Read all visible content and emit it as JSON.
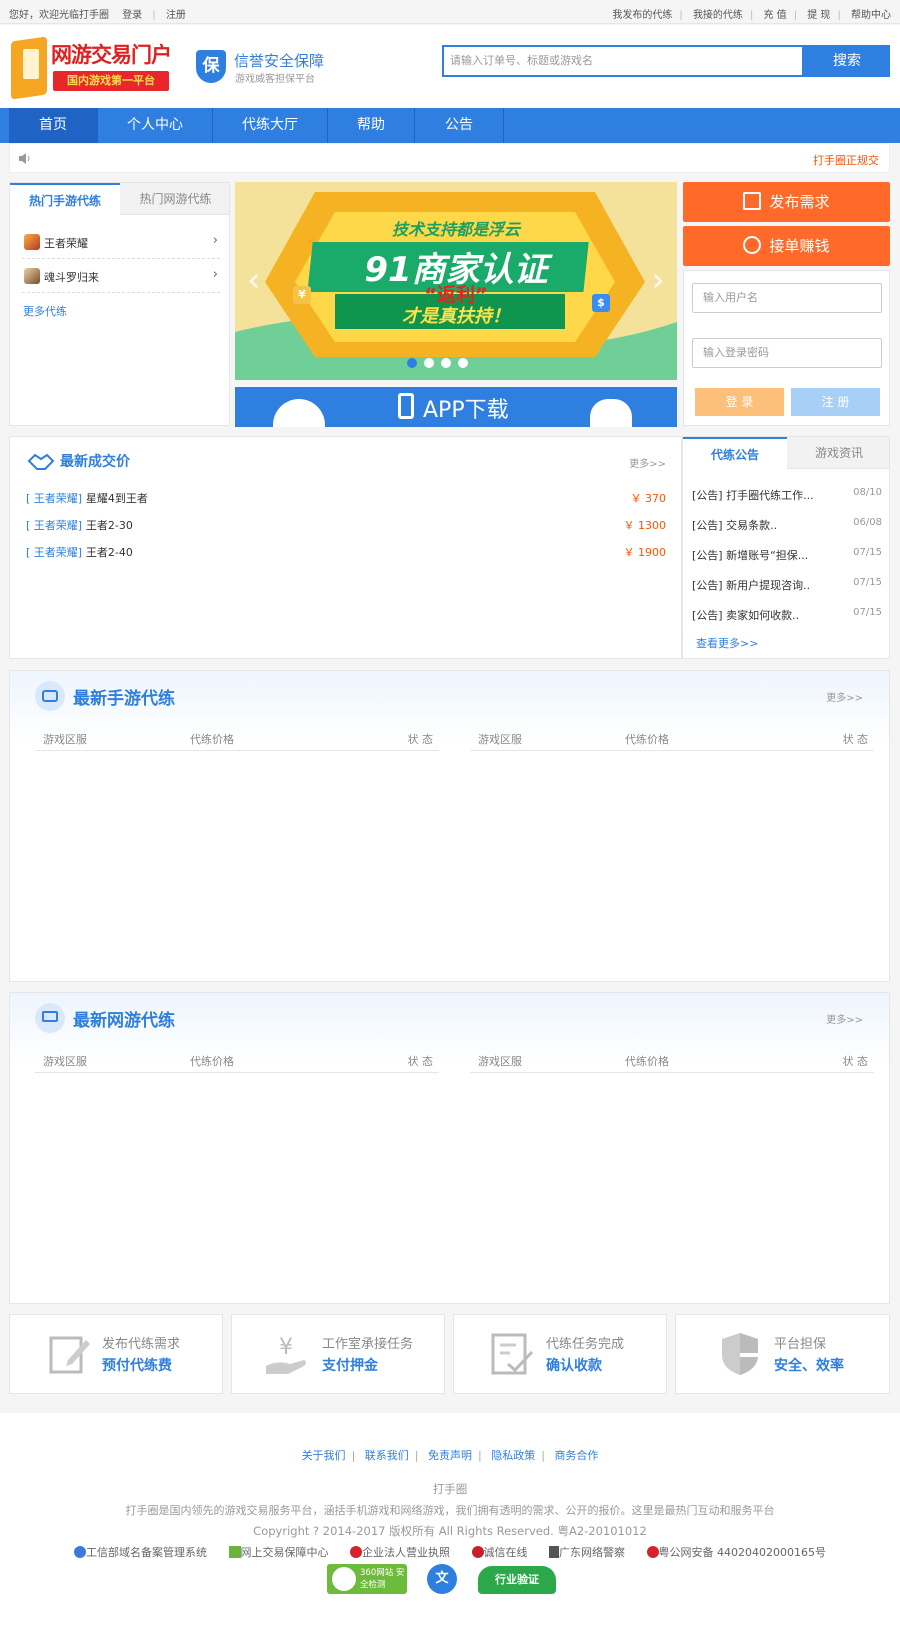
{
  "topbar": {
    "greeting": "您好，欢迎光临打手圈",
    "login": "登录",
    "register": "注册",
    "links": [
      "我发布的代练",
      "我接的代练",
      "充 值",
      "提 现",
      "帮助中心"
    ]
  },
  "header": {
    "logo_title": "网游交易门户",
    "logo_sub": "国内游戏第一平台",
    "shield_char": "保",
    "guarantee_title": "信誉安全保障",
    "guarantee_sub": "游戏威客担保平台",
    "search_placeholder": "请输入订单号、标题或游戏名",
    "search_button": "搜索"
  },
  "nav": [
    "首页",
    "个人中心",
    "代练大厅",
    "帮助",
    "公告"
  ],
  "notice": {
    "text": "打手圈正规交"
  },
  "hot": {
    "tabs": [
      "热门手游代练",
      "热门网游代练"
    ],
    "items": [
      "王者荣耀",
      "魂斗罗归来"
    ],
    "more": "更多代练"
  },
  "banner": {
    "line1": "技术支持都是浮云",
    "line2": "91商家认证",
    "line3": "“返利”",
    "line4": "才是真扶持！",
    "badge1": "¥",
    "badge2": "$",
    "dots": 4,
    "app_download": "APP下载"
  },
  "side": {
    "publish": "发布需求",
    "earn": "接单赚钱",
    "username_placeholder": "输入用户名",
    "password_placeholder": "输入登录密码",
    "login": "登 录",
    "register": "注 册"
  },
  "deals": {
    "title": "最新成交价",
    "more": "更多>>",
    "rows": [
      {
        "tag": "[ 王者荣耀]",
        "name": "星耀4到王者",
        "price": "￥ 370"
      },
      {
        "tag": "[ 王者荣耀]",
        "name": "王者2-30",
        "price": "￥ 1300"
      },
      {
        "tag": "[ 王者荣耀]",
        "name": "王者2-40",
        "price": "￥ 1900"
      }
    ]
  },
  "announce": {
    "tabs": [
      "代练公告",
      "游戏资讯"
    ],
    "items": [
      {
        "text": "[公告] 打手圈代练工作...",
        "date": "08/10"
      },
      {
        "text": "[公告] 交易条款..",
        "date": "06/08"
      },
      {
        "text": "[公告] 新增账号“担保...",
        "date": "07/15"
      },
      {
        "text": "[公告] 新用户提现咨询..",
        "date": "07/15"
      },
      {
        "text": "[公告] 卖家如何收款..",
        "date": "07/15"
      }
    ],
    "more": "查看更多>>"
  },
  "mobile_section": {
    "title": "最新手游代练",
    "more": "更多>>",
    "cols": [
      "游戏区服",
      "代练价格",
      "状 态"
    ]
  },
  "pc_section": {
    "title": "最新网游代练",
    "more": "更多>>",
    "cols": [
      "游戏区服",
      "代练价格",
      "状 态"
    ]
  },
  "steps": [
    {
      "t1": "发布代练需求",
      "t2": "预付代练费",
      "icon": "edit-icon"
    },
    {
      "t1": "工作室承接任务",
      "t2": "支付押金",
      "icon": "yuan-hand-icon"
    },
    {
      "t1": "代练任务完成",
      "t2": "确认收款",
      "icon": "checklist-icon"
    },
    {
      "t1": "平台担保",
      "t2": "安全、效率",
      "icon": "shield-icon"
    }
  ],
  "footer": {
    "links": [
      "关于我们",
      "联系我们",
      "免责声明",
      "隐私政策",
      "商务合作"
    ],
    "site": "打手圈",
    "desc": "打手圈是国内领先的游戏交易服务平台，涵括手机游戏和网络游戏，我们拥有透明的需求、公开的报价。这里是最热门互动和服务平台",
    "copyright": "Copyright ? 2014-2017 版权所有 All Rights Reserved. 粤A2-20101012",
    "badges": [
      "工信部域名备案管理系统",
      "网上交易保障中心",
      "企业法人营业执照",
      "诚信在线",
      "广东网络警察",
      "粤公网安备 44020402000165号"
    ],
    "seal1": "360网站 安全检测",
    "seal2": "文",
    "seal3": "行业验证"
  },
  "colors": {
    "primary": "#2f7fe0",
    "orange": "#ff6a2b",
    "price_red": "#ff5400"
  }
}
